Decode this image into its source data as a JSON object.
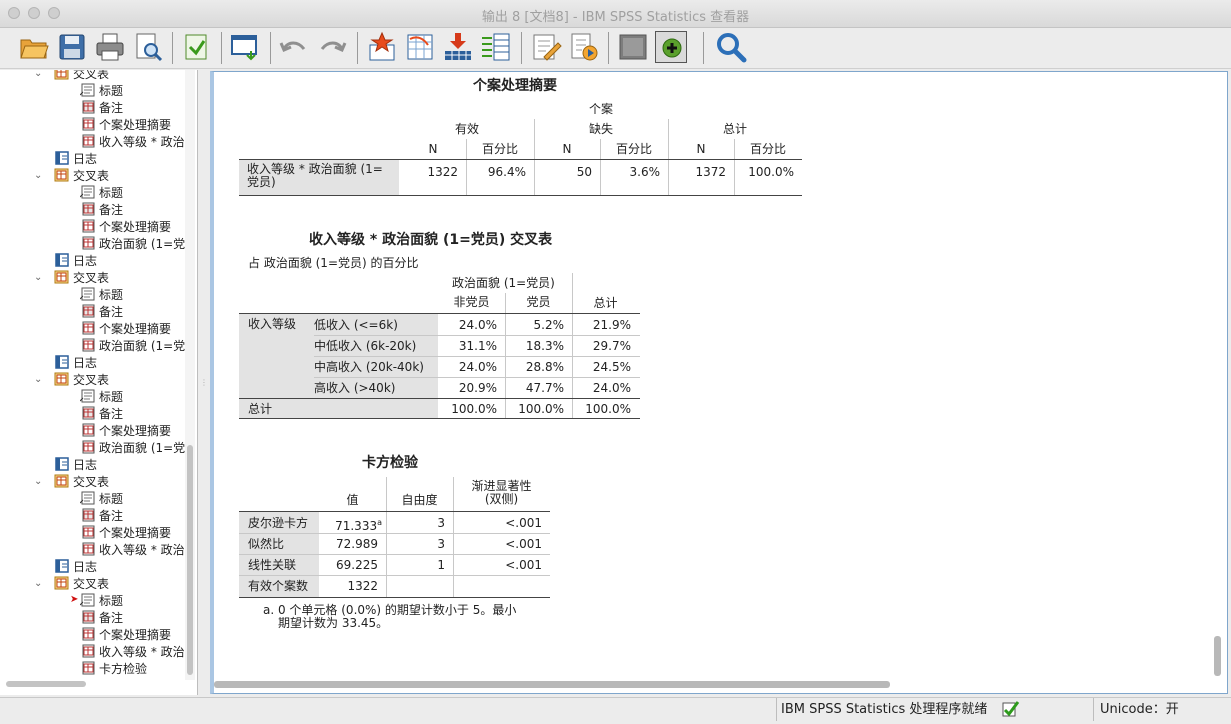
{
  "window": {
    "title": "输出 8 [文档8] - IBM SPSS Statistics 查看器"
  },
  "toolbar": {
    "buttons": [
      "open-icon",
      "save-icon",
      "print-icon",
      "print-preview-icon",
      "export-icon",
      "recall-dialog-icon",
      "undo-icon",
      "redo-icon",
      "goto-data-icon",
      "goto-case-icon",
      "insert-variable-icon",
      "variables-icon",
      "designate-window-icon",
      "run-script-icon",
      "hide-icon",
      "show-icon",
      "find-icon"
    ]
  },
  "outline": {
    "items": [
      {
        "label": "交叉表",
        "type": "crosstab",
        "level": 0
      },
      {
        "label": "标题",
        "type": "title",
        "level": 1
      },
      {
        "label": "备注",
        "type": "notes",
        "level": 1
      },
      {
        "label": "个案处理摘要",
        "type": "table",
        "level": 1
      },
      {
        "label": "收入等级 * 政治",
        "type": "table",
        "level": 1
      },
      {
        "label": "日志",
        "type": "log",
        "level": 0
      },
      {
        "label": "交叉表",
        "type": "crosstab",
        "level": 0
      },
      {
        "label": "标题",
        "type": "title",
        "level": 1
      },
      {
        "label": "备注",
        "type": "notes",
        "level": 1
      },
      {
        "label": "个案处理摘要",
        "type": "table",
        "level": 1
      },
      {
        "label": "政治面貌 (1=党",
        "type": "table",
        "level": 1
      },
      {
        "label": "日志",
        "type": "log",
        "level": 0
      },
      {
        "label": "交叉表",
        "type": "crosstab",
        "level": 0
      },
      {
        "label": "标题",
        "type": "title",
        "level": 1
      },
      {
        "label": "备注",
        "type": "notes",
        "level": 1
      },
      {
        "label": "个案处理摘要",
        "type": "table",
        "level": 1
      },
      {
        "label": "政治面貌 (1=党",
        "type": "table",
        "level": 1
      },
      {
        "label": "日志",
        "type": "log",
        "level": 0
      },
      {
        "label": "交叉表",
        "type": "crosstab",
        "level": 0
      },
      {
        "label": "标题",
        "type": "title",
        "level": 1
      },
      {
        "label": "备注",
        "type": "notes",
        "level": 1
      },
      {
        "label": "个案处理摘要",
        "type": "table",
        "level": 1
      },
      {
        "label": "政治面貌 (1=党",
        "type": "table",
        "level": 1
      },
      {
        "label": "日志",
        "type": "log",
        "level": 0
      },
      {
        "label": "交叉表",
        "type": "crosstab",
        "level": 0
      },
      {
        "label": "标题",
        "type": "title",
        "level": 1
      },
      {
        "label": "备注",
        "type": "notes",
        "level": 1
      },
      {
        "label": "个案处理摘要",
        "type": "table",
        "level": 1
      },
      {
        "label": "收入等级 * 政治",
        "type": "table",
        "level": 1
      },
      {
        "label": "日志",
        "type": "log",
        "level": 0
      },
      {
        "label": "交叉表",
        "type": "crosstab",
        "level": 0
      },
      {
        "label": "标题",
        "type": "title",
        "level": 1,
        "current": true
      },
      {
        "label": "备注",
        "type": "notes",
        "level": 1
      },
      {
        "label": "个案处理摘要",
        "type": "table",
        "level": 1
      },
      {
        "label": "收入等级 * 政治",
        "type": "table",
        "level": 1
      },
      {
        "label": "卡方检验",
        "type": "table",
        "level": 1
      }
    ]
  },
  "case_summary": {
    "title": "个案处理摘要",
    "group_header": "个案",
    "col_groups": [
      "有效",
      "缺失",
      "总计"
    ],
    "sub_headers": [
      "N",
      "百分比",
      "N",
      "百分比",
      "N",
      "百分比"
    ],
    "row_label": "收入等级 * 政治面貌 (1=党员)",
    "values": [
      "1322",
      "96.4%",
      "50",
      "3.6%",
      "1372",
      "100.0%"
    ]
  },
  "crosstab": {
    "title": "收入等级 * 政治面貌 (1=党员) 交叉表",
    "subtitle": "占 政治面貌 (1=党员) 的百分比",
    "col_var": "政治面貌 (1=党员)",
    "col_headers": [
      "非党员",
      "党员",
      "总计"
    ],
    "row_var": "收入等级",
    "rows": [
      {
        "label": "低收入 (<=6k)",
        "values": [
          "24.0%",
          "5.2%",
          "21.9%"
        ]
      },
      {
        "label": "中低收入 (6k-20k)",
        "values": [
          "31.1%",
          "18.3%",
          "29.7%"
        ]
      },
      {
        "label": "中高收入 (20k-40k)",
        "values": [
          "24.0%",
          "28.8%",
          "24.5%"
        ]
      },
      {
        "label": "高收入 (>40k)",
        "values": [
          "20.9%",
          "47.7%",
          "24.0%"
        ]
      }
    ],
    "total_label": "总计",
    "total_values": [
      "100.0%",
      "100.0%",
      "100.0%"
    ]
  },
  "chi_square": {
    "title": "卡方检验",
    "col_headers": [
      "值",
      "自由度",
      "渐进显著性",
      "(双侧)"
    ],
    "rows": [
      {
        "label": "皮尔逊卡方",
        "value": "71.333",
        "sup": "a",
        "df": "3",
        "sig": "<.001"
      },
      {
        "label": "似然比",
        "value": "72.989",
        "sup": "",
        "df": "3",
        "sig": "<.001"
      },
      {
        "label": "线性关联",
        "value": "69.225",
        "sup": "",
        "df": "1",
        "sig": "<.001"
      },
      {
        "label": "有效个案数",
        "value": "1322",
        "sup": "",
        "df": "",
        "sig": ""
      }
    ],
    "footnote_line1": "a. 0 个单元格 (0.0%) 的期望计数小于 5。最小",
    "footnote_line2": "期望计数为 33.45。"
  },
  "status": {
    "processor": "IBM SPSS Statistics 处理程序就绪",
    "unicode": "Unicode：开"
  }
}
